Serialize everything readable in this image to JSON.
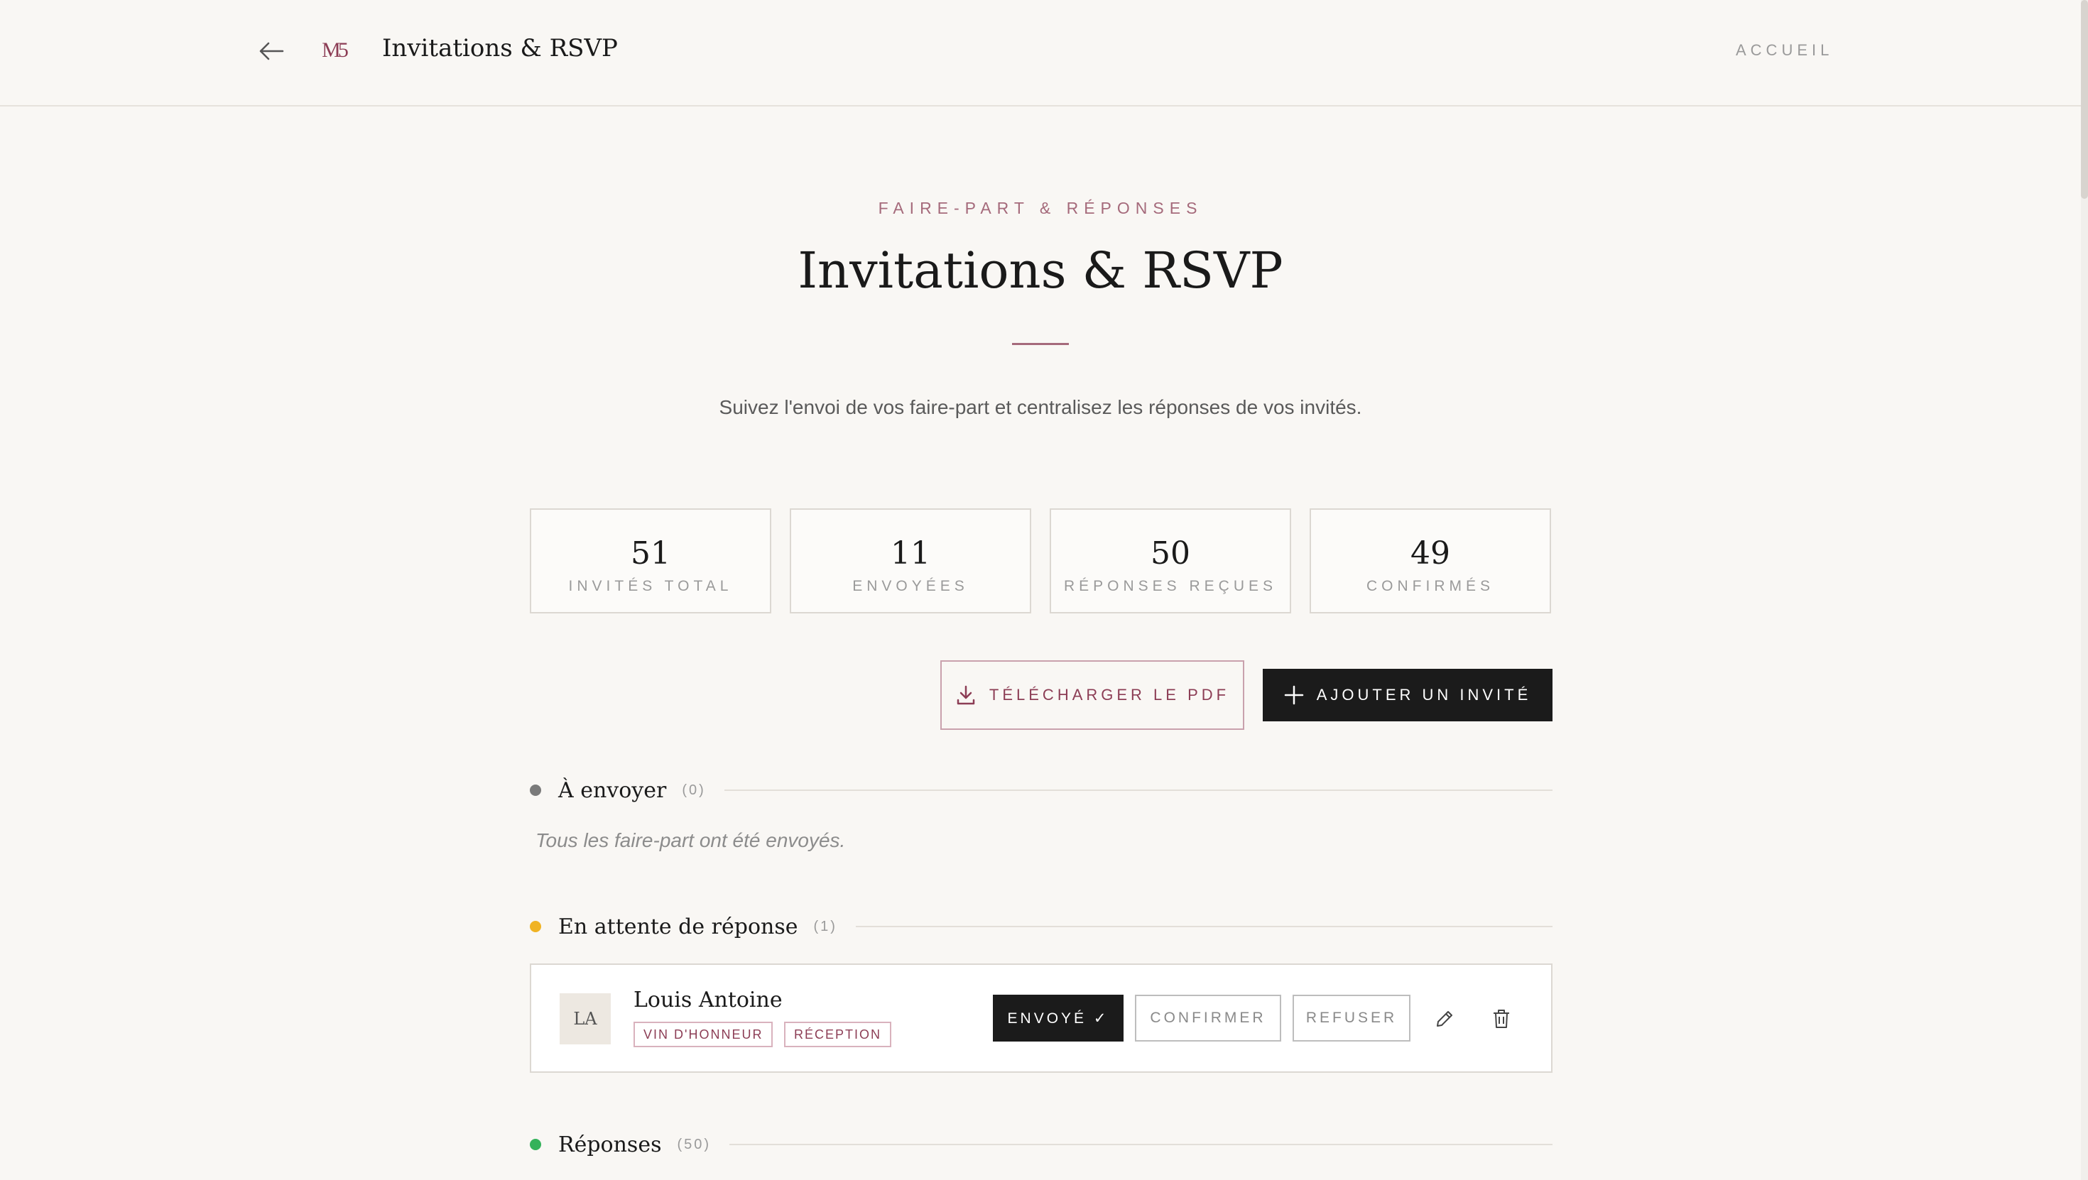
{
  "header": {
    "app_title": "Invitations & RSVP",
    "logo_text": "M5",
    "nav_home": "ACCUEIL"
  },
  "hero": {
    "eyebrow": "FAIRE-PART & RÉPONSES",
    "title": "Invitations & RSVP",
    "subtitle": "Suivez l'envoi de vos faire-part et centralisez les réponses de vos invités."
  },
  "stats": [
    {
      "value": "51",
      "label": "INVITÉS TOTAL"
    },
    {
      "value": "11",
      "label": "ENVOYÉES"
    },
    {
      "value": "50",
      "label": "RÉPONSES REÇUES"
    },
    {
      "value": "49",
      "label": "CONFIRMÉS"
    }
  ],
  "actions": {
    "download_pdf": "TÉLÉCHARGER LE PDF",
    "add_guest": "AJOUTER UN INVITÉ"
  },
  "sections": {
    "to_send": {
      "title": "À envoyer",
      "count": "(0)",
      "color": "#7a7a7a",
      "empty_message": "Tous les faire-part ont été envoyés."
    },
    "pending": {
      "title": "En attente de réponse",
      "count": "(1)",
      "color": "#f0b323"
    },
    "responses": {
      "title": "Réponses",
      "count": "(50)",
      "color": "#34b25a"
    }
  },
  "pending_guests": [
    {
      "initials": "LA",
      "name": "Louis Antoine",
      "tags": [
        "VIN D'HONNEUR",
        "RÉCEPTION"
      ],
      "sent_label": "ENVOYÉ ✓",
      "confirm_label": "CONFIRMER",
      "refuse_label": "REFUSER"
    }
  ],
  "colors": {
    "accent": "#8c3d55",
    "background": "#f9f7f4",
    "dark_button": "#1b1b1b"
  }
}
